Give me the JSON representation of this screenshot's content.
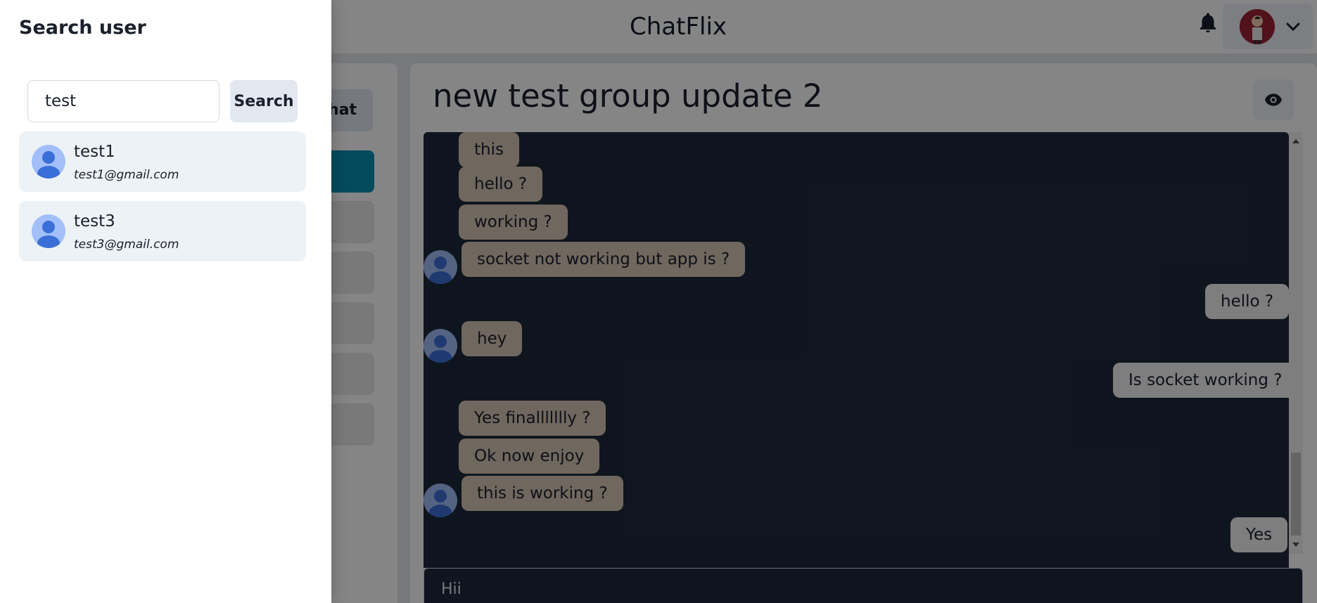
{
  "header": {
    "brand": "ChatFlix",
    "bell_icon": "bell-icon",
    "chevron_icon": "chevron-down-icon"
  },
  "sidebar": {
    "new_chat_label": "hat"
  },
  "chat": {
    "title": "new test group update 2",
    "eye_icon": "eye-icon",
    "messages": [
      {
        "text": "this",
        "side": "in",
        "avatar": false
      },
      {
        "text": "hello ?",
        "side": "in",
        "avatar": false
      },
      {
        "text": "working ?",
        "side": "in",
        "avatar": false
      },
      {
        "text": "socket not working but app is ?",
        "side": "in",
        "avatar": true
      },
      {
        "text": "hello ?",
        "side": "out"
      },
      {
        "text": "hey",
        "side": "in",
        "avatar": true
      },
      {
        "text": "Is socket working ?",
        "side": "out"
      },
      {
        "text": "Yes finallllllly ?",
        "side": "in",
        "avatar": false
      },
      {
        "text": "Ok now enjoy",
        "side": "in",
        "avatar": false
      },
      {
        "text": "this is working ?",
        "side": "in",
        "avatar": true
      },
      {
        "text": "Yes",
        "side": "out"
      }
    ],
    "composer_value": "Hii"
  },
  "drawer": {
    "title": "Search user",
    "search_value": "test",
    "search_button": "Search",
    "results": [
      {
        "name": "test1",
        "email": "test1@gmail.com"
      },
      {
        "name": "test3",
        "email": "test3@gmail.com"
      }
    ]
  },
  "colors": {
    "chat_bg": "#1e293b",
    "incoming_bubble": "#d6c6b5",
    "outgoing_bubble": "#f2f2f2",
    "active_chat": "#0891b2",
    "overlay": "rgba(0,0,0,0.48)"
  }
}
